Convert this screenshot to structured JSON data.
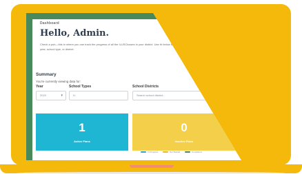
{
  "colors": {
    "shell": "#f5b90c",
    "notch": "#f18d73",
    "primary": "#4a8a5a",
    "active_card": "#1fb6d4",
    "inactive_card": "#f3cf4a",
    "legend_1": "#2ba3d8",
    "legend_2": "#f0b429",
    "legend_3": "#4a8a5a"
  },
  "app": {
    "brand": "Dashboard",
    "greeting": "Hello, Admin.",
    "intro": "Check a pub—this in where you can track the progress of all the ILUSClusses in your district. Use th below to view list bar chart by year, school type, or district."
  },
  "summary": {
    "heading": "Summary",
    "subtitle": "You're currently viewing data for:",
    "filters": {
      "year": {
        "label": "Year",
        "value": "2023"
      },
      "school_types": {
        "label": "School Types",
        "value": "Lt"
      },
      "school_districts": {
        "label": "School Districts",
        "placeholder": "Search school district..."
      }
    },
    "cards": [
      {
        "value": "1",
        "caption": "Active Plans"
      },
      {
        "value": "0",
        "caption": "Inactive Plans"
      }
    ]
  },
  "legend": [
    "In Progress",
    "Not Started",
    "Completed"
  ]
}
